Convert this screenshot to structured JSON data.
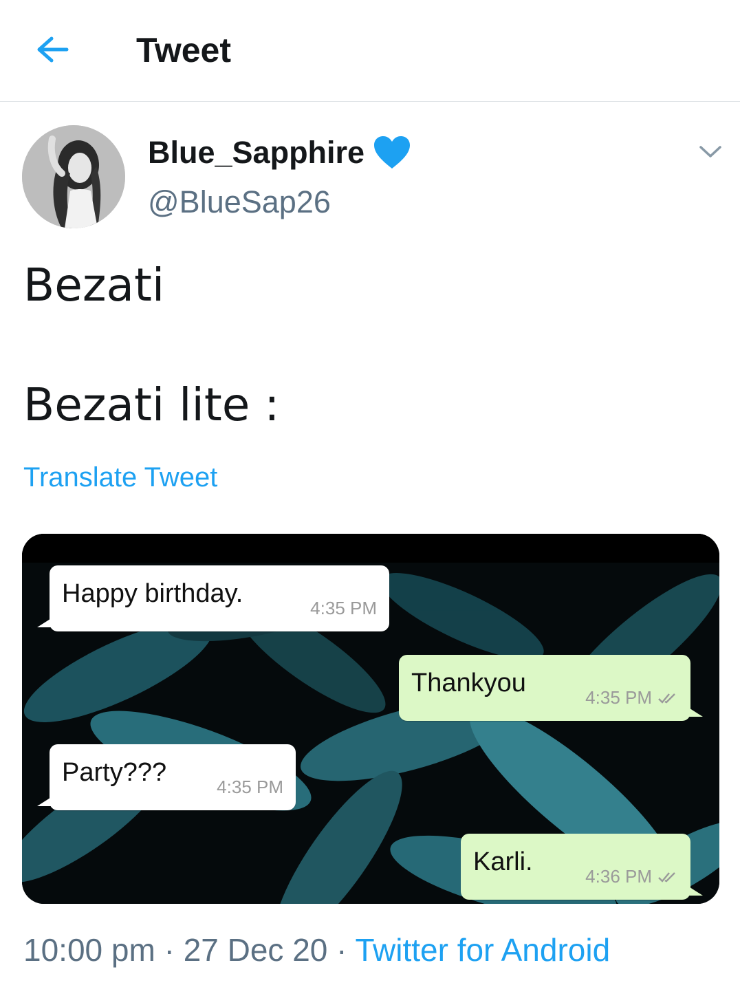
{
  "header": {
    "title": "Tweet",
    "back_icon": "arrow-left-icon"
  },
  "author": {
    "display_name": "Blue_Sapphire",
    "handle": "@BlueSap26",
    "verified_icon": "blue-heart-icon",
    "more_icon": "chevron-down-icon"
  },
  "tweet": {
    "line1": "Bezati",
    "line2": "Bezati lite :",
    "translate_label": "Translate Tweet"
  },
  "media": {
    "messages": [
      {
        "text": "Happy birthday.",
        "time": "4:35 PM",
        "direction": "incoming"
      },
      {
        "text": "Thankyou",
        "time": "4:35 PM",
        "direction": "outgoing"
      },
      {
        "text": "Party???",
        "time": "4:35 PM",
        "direction": "incoming"
      },
      {
        "text": "Karli.",
        "time": "4:36 PM",
        "direction": "outgoing"
      }
    ]
  },
  "meta": {
    "time": "10:00 pm",
    "date": "27 Dec 20",
    "separator": "·",
    "source": "Twitter for Android"
  },
  "colors": {
    "accent": "#1da1f2",
    "secondary_text": "#5b7083",
    "outgoing_bubble": "#dcf8c6",
    "incoming_bubble": "#ffffff"
  }
}
